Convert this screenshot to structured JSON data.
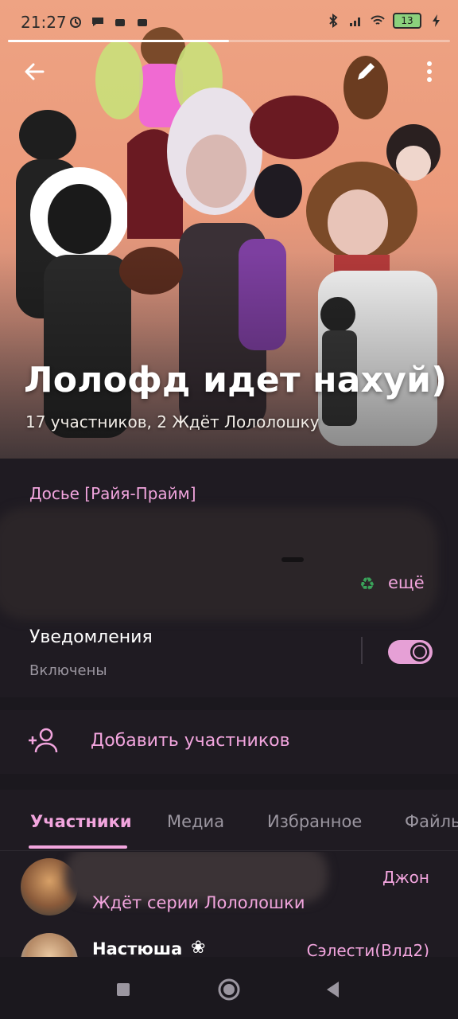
{
  "status_bar": {
    "time": "21:27",
    "battery": "13"
  },
  "header": {
    "group_title": "Лолофд идет нахуй)",
    "group_subtitle": "17 участников, 2 Ждёт Лололошку",
    "story_progress": 0.5
  },
  "info": {
    "label": "Досье [Райя-Прайм]",
    "more_link": "ещё",
    "notifications_title": "Уведомления",
    "notifications_status": "Включены",
    "notifications_enabled": true
  },
  "actions": {
    "add_members_label": "Добавить участников"
  },
  "tabs": [
    {
      "label": "Участники",
      "active": true
    },
    {
      "label": "Медиа",
      "active": false
    },
    {
      "label": "Избранное",
      "active": false
    },
    {
      "label": "Файлы",
      "active": false
    }
  ],
  "members": [
    {
      "name": "",
      "status": "Ждёт серии Лололошки",
      "role": "Джон"
    },
    {
      "name": "Настюша",
      "status": "",
      "role": "Сэлести(Влд2)"
    }
  ],
  "colors": {
    "accent": "#f2a5de",
    "background": "#1f1b22",
    "header_peach": "#eea383"
  }
}
